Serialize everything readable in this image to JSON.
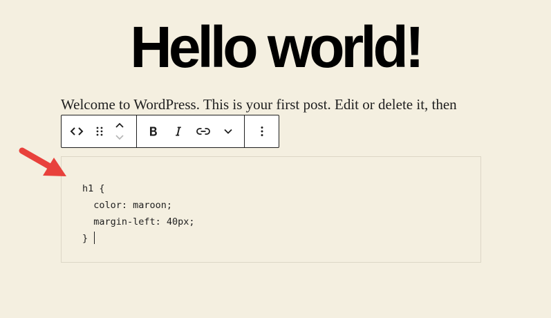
{
  "post": {
    "title": "Hello world!",
    "paragraph": "Welcome to WordPress. This is your first post. Edit or delete it, then"
  },
  "toolbar": {
    "html_icon": "code-brackets-icon",
    "drag_icon": "drag-handle-icon",
    "move_up_icon": "chevron-up-icon",
    "move_down_icon": "chevron-down-icon",
    "bold_icon": "bold-icon",
    "italic_icon": "italic-icon",
    "link_icon": "link-icon",
    "more_icon": "chevron-down-icon",
    "options_icon": "vertical-ellipsis-icon"
  },
  "code_block": {
    "lines": [
      "h1 {",
      "  color: maroon;",
      "  margin-left: 40px;",
      "}"
    ]
  },
  "colors": {
    "page_background": "#f4efe0",
    "annotation_arrow": "#e8413c",
    "text": "#1e1e1e"
  }
}
